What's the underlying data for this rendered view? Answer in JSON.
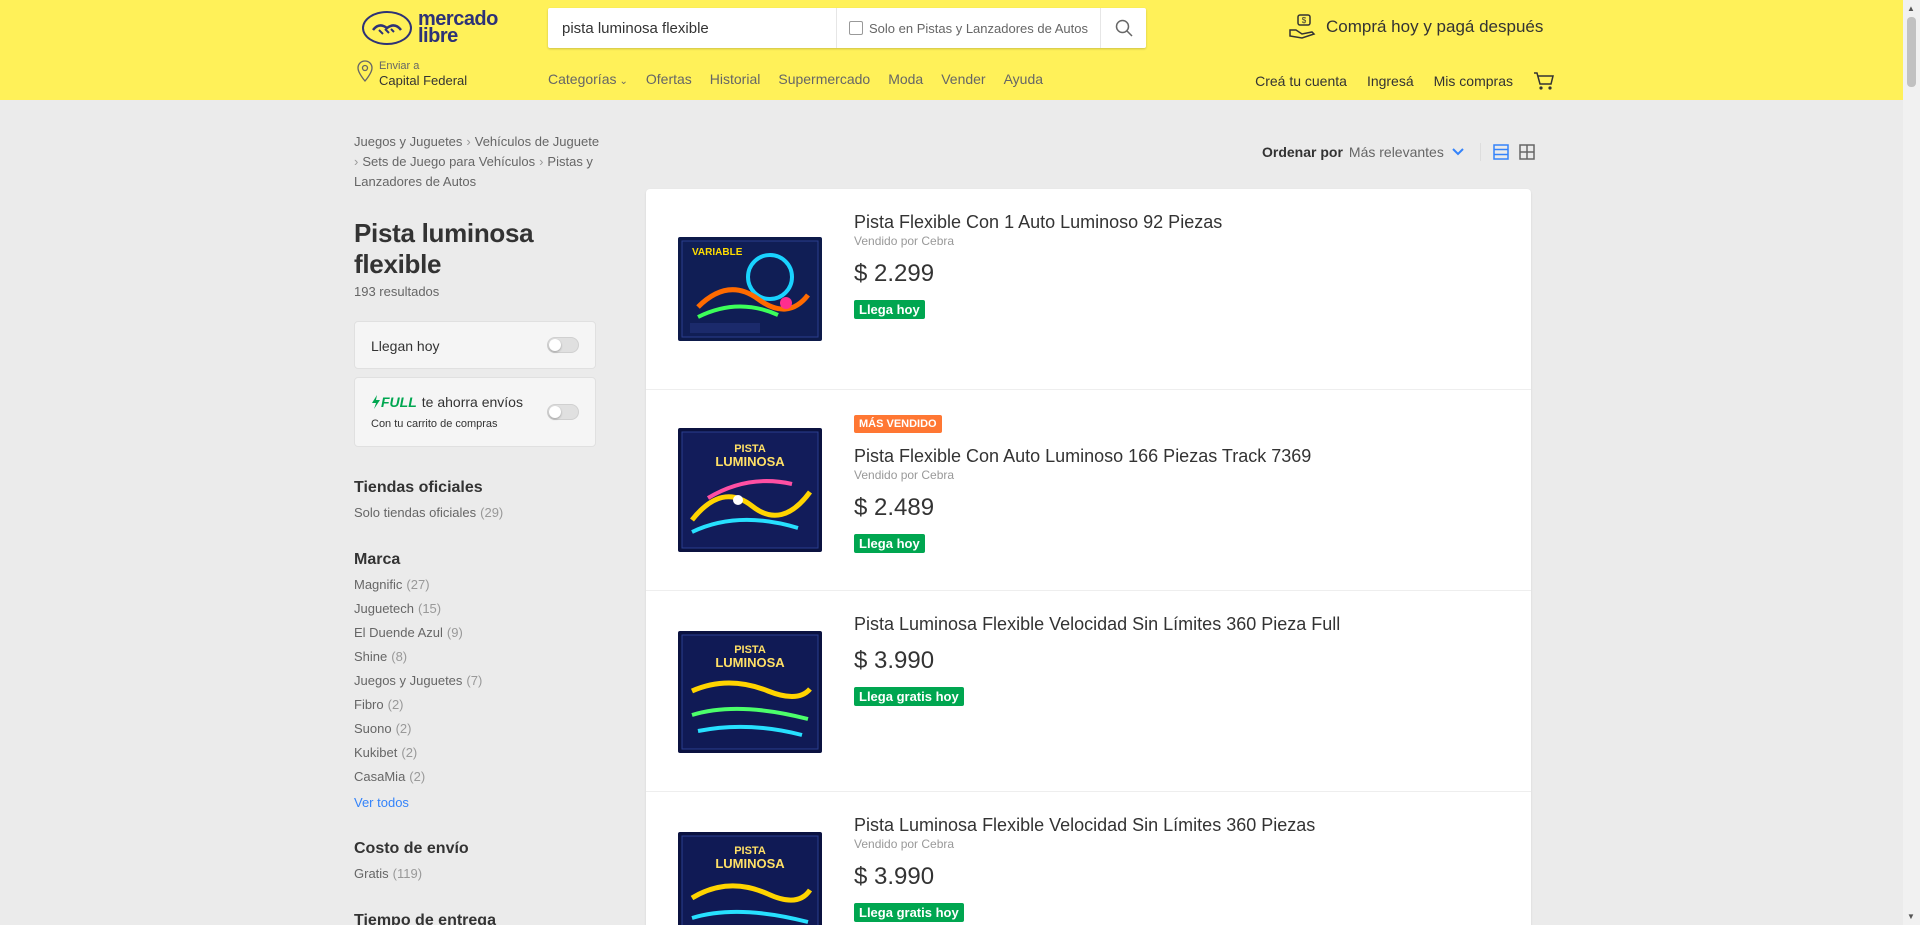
{
  "header": {
    "logo_line1": "mercado",
    "logo_line2": "libre",
    "search_value": "pista luminosa flexible",
    "search_filter_label": "Solo en Pistas y Lanzadores de Autos",
    "promo": "Comprá hoy y pagá después",
    "location_small": "Enviar a",
    "location_city": "Capital Federal",
    "nav": [
      "Categorías",
      "Ofertas",
      "Historial",
      "Supermercado",
      "Moda",
      "Vender",
      "Ayuda"
    ],
    "user_nav": [
      "Creá tu cuenta",
      "Ingresá",
      "Mis compras"
    ]
  },
  "breadcrumb": [
    "Juegos y Juguetes",
    "Vehículos de Juguete",
    "Sets de Juego para Vehículos",
    "Pistas y Lanzadores de Autos"
  ],
  "page_title": "Pista luminosa flexible",
  "results_count": "193 resultados",
  "filters": {
    "today_label": "Llegan hoy",
    "full_brand": "FULL",
    "full_text": "te ahorra envíos",
    "full_sub": "Con tu carrito de compras"
  },
  "tiendas": {
    "title": "Tiendas oficiales",
    "item": "Solo tiendas oficiales",
    "count": "(29)"
  },
  "marca": {
    "title": "Marca",
    "items": [
      {
        "name": "Magnific",
        "count": "(27)"
      },
      {
        "name": "Juguetech",
        "count": "(15)"
      },
      {
        "name": "El Duende Azul",
        "count": "(9)"
      },
      {
        "name": "Shine",
        "count": "(8)"
      },
      {
        "name": "Juegos y Juguetes",
        "count": "(7)"
      },
      {
        "name": "Fibro",
        "count": "(2)"
      },
      {
        "name": "Suono",
        "count": "(2)"
      },
      {
        "name": "Kukibet",
        "count": "(2)"
      },
      {
        "name": "CasaMia",
        "count": "(2)"
      }
    ],
    "ver_todos": "Ver todos"
  },
  "envio": {
    "title": "Costo de envío",
    "item": "Gratis",
    "count": "(119)"
  },
  "entrega_title": "Tiempo de entrega",
  "sort": {
    "label": "Ordenar por",
    "value": "Más relevantes"
  },
  "items": [
    {
      "badge": "",
      "title": "Pista Flexible Con 1 Auto Luminoso 92 Piezas",
      "seller": "Vendido por Cebra",
      "price": "$ 2.299",
      "ship": "Llega hoy"
    },
    {
      "badge": "MÁS VENDIDO",
      "title": "Pista Flexible Con Auto Luminoso 166 Piezas Track 7369",
      "seller": "Vendido por Cebra",
      "price": "$ 2.489",
      "ship": "Llega hoy"
    },
    {
      "badge": "",
      "title": "Pista Luminosa Flexible Velocidad Sin Límites 360 Pieza Full",
      "seller": "",
      "price": "$ 3.990",
      "ship": "Llega gratis hoy"
    },
    {
      "badge": "",
      "title": "Pista Luminosa Flexible Velocidad Sin Límites 360 Piezas",
      "seller": "Vendido por Cebra",
      "price": "$ 3.990",
      "ship": "Llega gratis hoy"
    }
  ],
  "box_art": {
    "item1": "VARIABLE",
    "item2_line1": "PISTA",
    "item2_line2": "LUMINOSA",
    "item3_line1": "PISTA",
    "item3_line2": "LUMINOSA",
    "item4_line1": "PISTA",
    "item4_line2": "LUMINOSA"
  },
  "colors": {
    "header_bg": "#fff159",
    "accent_blue": "#3483fa",
    "ship_green": "#00a650",
    "badge_orange": "#ff7733"
  }
}
